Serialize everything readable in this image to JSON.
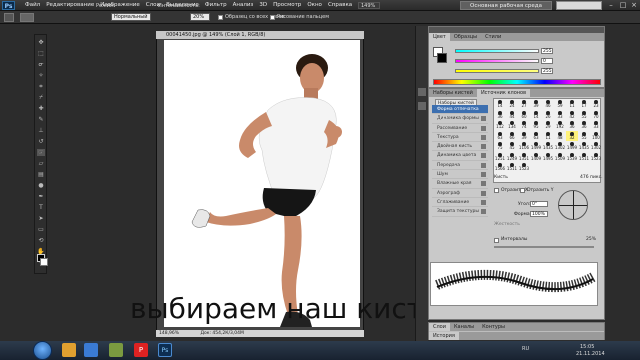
{
  "app": {
    "logo": "Ps"
  },
  "menu": [
    "Файл",
    "Редактирование",
    "Изображение",
    "Слои",
    "Выделение",
    "Фильтр",
    "Анализ",
    "3D",
    "Просмотр",
    "Окно",
    "Справка"
  ],
  "zoom": "149%",
  "workspace": "Основная рабочая среда",
  "options": {
    "mode_label": "Режим:",
    "mode_value": "Нормальный",
    "intensity_label": "Интенсивность:",
    "intensity_value": "20%",
    "sample_all": "Образец со всех слоев",
    "finger": "Рисование пальцем"
  },
  "document": {
    "title": "00041450.jpg @ 149% (Слой 1, RGB/8)",
    "zoom": "148,96%",
    "status": "Док: 454,2К/3,04М"
  },
  "caption": "выбираем наш кисть",
  "color_panel": {
    "tabs": [
      "Цвет",
      "Образцы",
      "Стили"
    ],
    "values": [
      "255",
      "0",
      "255"
    ]
  },
  "brush_panel": {
    "tabs": [
      "Наборы кистей",
      "Источник клонов"
    ],
    "presets_button": "Наборы кистей",
    "items": [
      "Форма отпечатка кисти",
      "Динамика формы",
      "Рассеивание",
      "Текстура",
      "Двойная кисть",
      "Динамика цвета",
      "Передача",
      "Шум",
      "Влажные края",
      "Аэрограф",
      "Сглаживание",
      "Защита текстуры"
    ],
    "grid_sizes": [
      "14",
      "24",
      "27",
      "39",
      "46",
      "59",
      "11",
      "17",
      "23",
      "36",
      "44",
      "60",
      "14",
      "26",
      "33",
      "42",
      "55",
      "70",
      "112",
      "134",
      "74",
      "95",
      "29",
      "192",
      "36",
      "36",
      "33",
      "63",
      "66",
      "39",
      "63",
      "11",
      "48",
      "32",
      "55",
      "100",
      "75",
      "45",
      "1106",
      "1499",
      "1435",
      "1302",
      "1499",
      "1435",
      "1302",
      "1251",
      "1249",
      "1351",
      "1409",
      "1495",
      "1509",
      "1539",
      "1511",
      "1523",
      "1566",
      "1511",
      "1523"
    ],
    "flip_x": "Отразить X",
    "flip_y": "Отразить Y",
    "angle_label": "Угол:",
    "angle_value": "0°",
    "roundness_label": "Форма:",
    "roundness_value": "100%",
    "hardness_label": "Жесткость",
    "spacing_label": "Интервалы",
    "spacing_value": "25%",
    "size_label": "Кисть",
    "size_value": "476 пикс."
  },
  "bottom_panel": {
    "tabs": [
      "Слои",
      "Каналы",
      "Контуры"
    ],
    "history": "История"
  },
  "taskbar": {
    "lang": "RU",
    "time": "15:05",
    "date": "21.11.2014"
  }
}
